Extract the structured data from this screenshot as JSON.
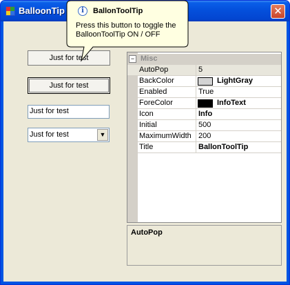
{
  "window": {
    "title": "BalloonTip T",
    "close_glyph": "✕",
    "icon": "app-icon"
  },
  "buttons": {
    "button1_label": "Just for test",
    "button2_label": "Just for test"
  },
  "textbox": {
    "value": "Just for test"
  },
  "combobox": {
    "value": "Just for test",
    "arrow_glyph": "▼"
  },
  "property_grid": {
    "category": "Misc",
    "collapse_glyph": "−",
    "rows": [
      {
        "name": "AutoPop",
        "value": "5"
      },
      {
        "name": "BackColor",
        "value": "LightGray",
        "color": "#d3d3d3"
      },
      {
        "name": "Enabled",
        "value": "True"
      },
      {
        "name": "ForeColor",
        "value": "InfoText",
        "color": "#000000"
      },
      {
        "name": "Icon",
        "value": "Info"
      },
      {
        "name": "Initial",
        "value": "500"
      },
      {
        "name": "MaximumWidth",
        "value": "200"
      },
      {
        "name": "Title",
        "value": "BallonToolTip"
      }
    ]
  },
  "help_panel": {
    "title": "AutoPop"
  },
  "balloon": {
    "icon_glyph": "i",
    "title": "BallonToolTip",
    "text": "Press this button to toggle the BalloonToolTip ON / OFF"
  }
}
